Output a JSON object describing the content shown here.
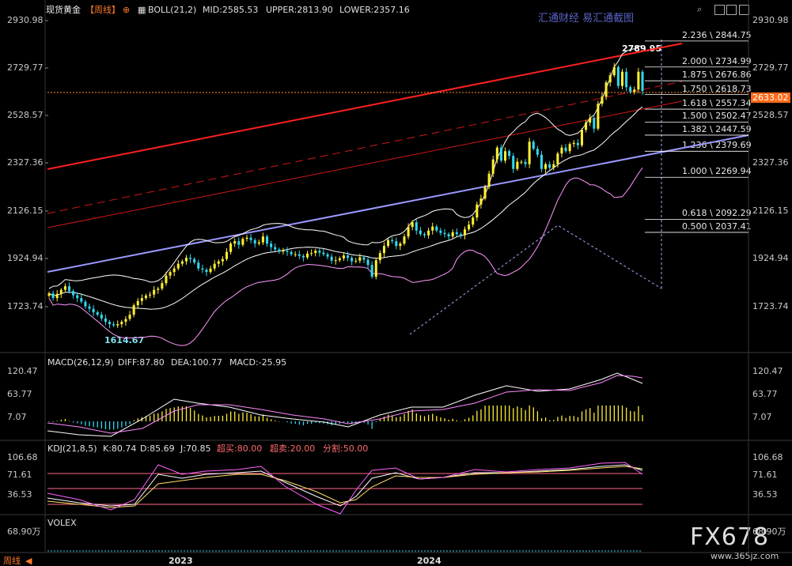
{
  "header": {
    "symbol": "现货黄金",
    "period": "【周线】",
    "boll_params": "BOLL(21,2)",
    "mid": "MID:2585.53",
    "upper": "UPPER:2813.90",
    "lower": "LOWER:2357.16"
  },
  "watermark": "汇通财经 易汇通截图",
  "brand": "FX678",
  "brand_url": "www.365jz.com",
  "price_tag": "2633.02",
  "annotations": {
    "high": "2789.95",
    "low": "1614.67"
  },
  "price_axis": [
    "2930.98",
    "2729.77",
    "2528.57",
    "2327.36",
    "2126.15",
    "1924.94",
    "1723.74"
  ],
  "fib_levels": [
    {
      "label": "2.236 \\ 2844.75",
      "value": 2844.75
    },
    {
      "label": "2.000 \\ 2734.99",
      "value": 2734.99
    },
    {
      "label": "1.875 \\ 2676.86",
      "value": 2676.86
    },
    {
      "label": "1.750 \\ 2618.73",
      "value": 2618.73
    },
    {
      "label": "1.618 \\ 2557.34",
      "value": 2557.34
    },
    {
      "label": "1.500 \\ 2502.47",
      "value": 2502.47
    },
    {
      "label": "1.382 \\ 2447.59",
      "value": 2447.59
    },
    {
      "label": "1.236 \\ 2379.69",
      "value": 2379.69
    },
    {
      "label": "1.000 \\ 2269.94",
      "value": 2269.94
    },
    {
      "label": "0.618 \\ 2092.29",
      "value": 2092.29
    },
    {
      "label": "0.500 \\ 2037.41",
      "value": 2037.41
    }
  ],
  "macd": {
    "title": "MACD(26,12,9)",
    "diff": "DIFF:87.80",
    "dea": "DEA:100.77",
    "macd": "MACD:-25.95",
    "axis": [
      "120.47",
      "63.77",
      "7.07"
    ]
  },
  "kdj": {
    "title": "KDJ(21,8,5)",
    "k": "K:80.74",
    "d": "D:85.69",
    "j": "J:70.85",
    "overbought": "超买:80.00",
    "oversold": "超卖:20.00",
    "split": "分割:50.00",
    "axis": [
      "106.68",
      "71.61",
      "36.53"
    ]
  },
  "volume": {
    "title": "VOLEX",
    "axis_left": "68.90万",
    "axis_right": "68.90万"
  },
  "x_axis": [
    "2023",
    "2024"
  ],
  "bottom_tab": "周线",
  "colors": {
    "up": "#ffee33",
    "down": "#33d6ee",
    "trend_red": "#ff2020",
    "trend_blue": "#9999ff",
    "boll": "#ffffff",
    "boll_lower": "#ff99ff",
    "price_tag_bg": "#ff6a1a"
  },
  "chart_data": {
    "type": "candlestick",
    "title": "现货黄金【周线】",
    "ylim": [
      1660,
      2950
    ],
    "indicators": {
      "BOLL": {
        "mid": 2585.53,
        "upper": 2813.9,
        "lower": 2357.16
      },
      "MACD": {
        "diff": 87.8,
        "dea": 100.77,
        "macd": -25.95
      },
      "KDJ": {
        "k": 80.74,
        "d": 85.69,
        "j": 70.85,
        "overbought": 80.0,
        "oversold": 20.0,
        "split": 50.0
      }
    },
    "closes": [
      1780,
      1760,
      1778,
      1795,
      1810,
      1790,
      1772,
      1760,
      1745,
      1725,
      1715,
      1700,
      1690,
      1674,
      1660,
      1650,
      1645,
      1650,
      1660,
      1672,
      1690,
      1730,
      1748,
      1760,
      1771,
      1775,
      1795,
      1800,
      1823,
      1855,
      1870,
      1885,
      1905,
      1915,
      1930,
      1925,
      1910,
      1885,
      1880,
      1870,
      1885,
      1905,
      1915,
      1925,
      1955,
      1990,
      2000,
      1985,
      2010,
      2015,
      2005,
      1990,
      1995,
      2020,
      1990,
      1975,
      1965,
      1958,
      1960,
      1955,
      1945,
      1945,
      1938,
      1932,
      1948,
      1950,
      1960,
      1952,
      1945,
      1935,
      1918,
      1920,
      1928,
      1940,
      1930,
      1915,
      1918,
      1932,
      1922,
      1900,
      1850,
      1920,
      1950,
      1980,
      2005,
      2000,
      1980,
      1990,
      2020,
      2060,
      2080,
      2045,
      2030,
      2025,
      2045,
      2062,
      2045,
      2035,
      2030,
      2020,
      2038,
      2030,
      2025,
      2050,
      2070,
      2100,
      2155,
      2180,
      2230,
      2285,
      2345,
      2395,
      2340,
      2380,
      2360,
      2305,
      2335,
      2335,
      2325,
      2420,
      2390,
      2365,
      2305,
      2325,
      2310,
      2325,
      2370,
      2395,
      2380,
      2410,
      2415,
      2405,
      2470,
      2500,
      2520,
      2475,
      2580,
      2610,
      2670,
      2700,
      2735,
      2655,
      2715,
      2650,
      2630,
      2640,
      2715,
      2634
    ],
    "price_axis_ticks": [
      2930.98,
      2729.77,
      2528.57,
      2327.36,
      2126.15,
      1924.94,
      1723.74
    ],
    "macd_axis_ticks": [
      120.47,
      63.77,
      7.07
    ],
    "kdj_axis_ticks": [
      106.68,
      71.61,
      36.53
    ],
    "x_ticks": [
      "2023",
      "2024"
    ]
  }
}
